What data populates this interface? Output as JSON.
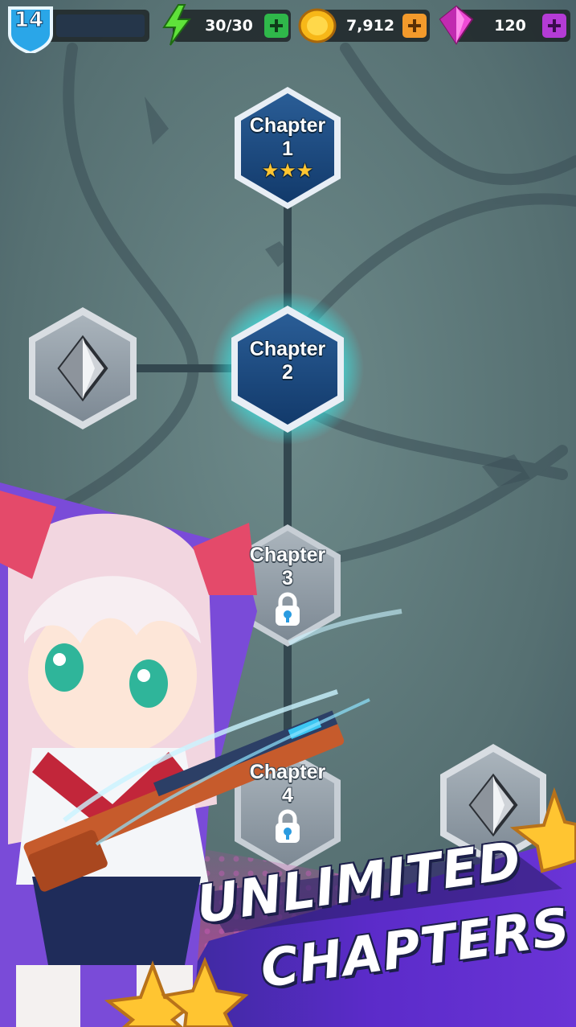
{
  "hud": {
    "level": "14",
    "energy": "30/30",
    "coins": "7,912",
    "gems": "120",
    "icons": {
      "level": "shield-badge-icon",
      "energy": "lightning-icon",
      "coins": "gold-coin-icon",
      "gems": "pink-gem-icon",
      "add": "plus-icon"
    },
    "colors": {
      "energy_plus": "#2fb84a",
      "coins_plus": "#f39a2b",
      "gems_plus": "#b43bd6",
      "level_badge": "#2aa6e8"
    }
  },
  "chapters": [
    {
      "label": "Chapter",
      "number": "1",
      "stars": "★★★",
      "state": "completed"
    },
    {
      "label": "Chapter",
      "number": "2",
      "state": "current"
    },
    {
      "label": "Chapter",
      "number": "3",
      "state": "locked",
      "icon": "lock-icon"
    },
    {
      "label": "Chapter",
      "number": "4",
      "state": "locked",
      "icon": "lock-icon"
    }
  ],
  "bonus_nodes": [
    {
      "icon": "silver-crystal-icon"
    },
    {
      "icon": "silver-crystal-icon"
    }
  ],
  "banner": {
    "line1": "UNLIMITED",
    "line2": "CHAPTERS",
    "colors": {
      "band": "#5b2bc9",
      "accent": "#d23aa8"
    }
  },
  "character": {
    "icon": "anime-girl-with-rifle-illustration"
  }
}
